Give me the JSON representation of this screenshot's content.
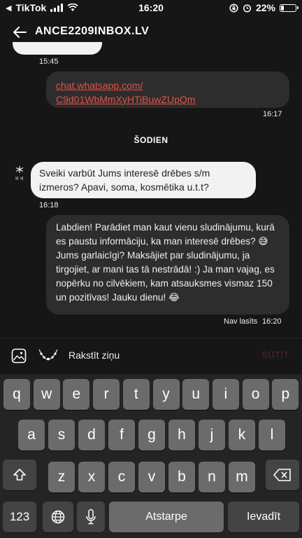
{
  "status_bar": {
    "carrier": "TikTok",
    "time": "16:20",
    "battery": "22%",
    "battery_level": 0.22
  },
  "header": {
    "title": "ANCE2209INBOX.LV"
  },
  "messages": [
    {
      "time": "15:45"
    },
    {
      "link_line1": "chat.whatsapp.com/",
      "link_line2": "C9d01WbMmXyHTiBuwZUpQm",
      "time": "16:17"
    },
    {
      "text": "Sveiki varbūt Jums interesē drēbes s/m izmeros? Apavi, soma, kosmētika u.t.t?",
      "time": "16:18"
    },
    {
      "text": "Labdien! Parādiet man kaut vienu sludinājumu, kurā es paustu informāciju, ka man interesē drēbes? 😅 Jums garlaicīgi? Maksājiet par sludinājumu, ja tirgojiet, ar mani tas tā nestrādā! :) Ja man vajag, es nopērku no cilvēkiem, kam atsauksmes vismaz 150 un pozitīvas! Jauku dienu! 😂",
      "status": "Nav lasīts",
      "time": "16:20"
    }
  ],
  "date_divider": "ŠODIEN",
  "composer": {
    "placeholder": "Rakstīt ziņu",
    "send_label": "SŪTĪT"
  },
  "keyboard": {
    "row1": [
      "q",
      "w",
      "e",
      "r",
      "t",
      "y",
      "u",
      "i",
      "o",
      "p"
    ],
    "row2": [
      "a",
      "s",
      "d",
      "f",
      "g",
      "h",
      "j",
      "k",
      "l"
    ],
    "row3": [
      "z",
      "x",
      "c",
      "v",
      "b",
      "n",
      "m"
    ],
    "numbers_label": "123",
    "space_label": "Atstarpe",
    "return_label": "Ievadīt"
  }
}
